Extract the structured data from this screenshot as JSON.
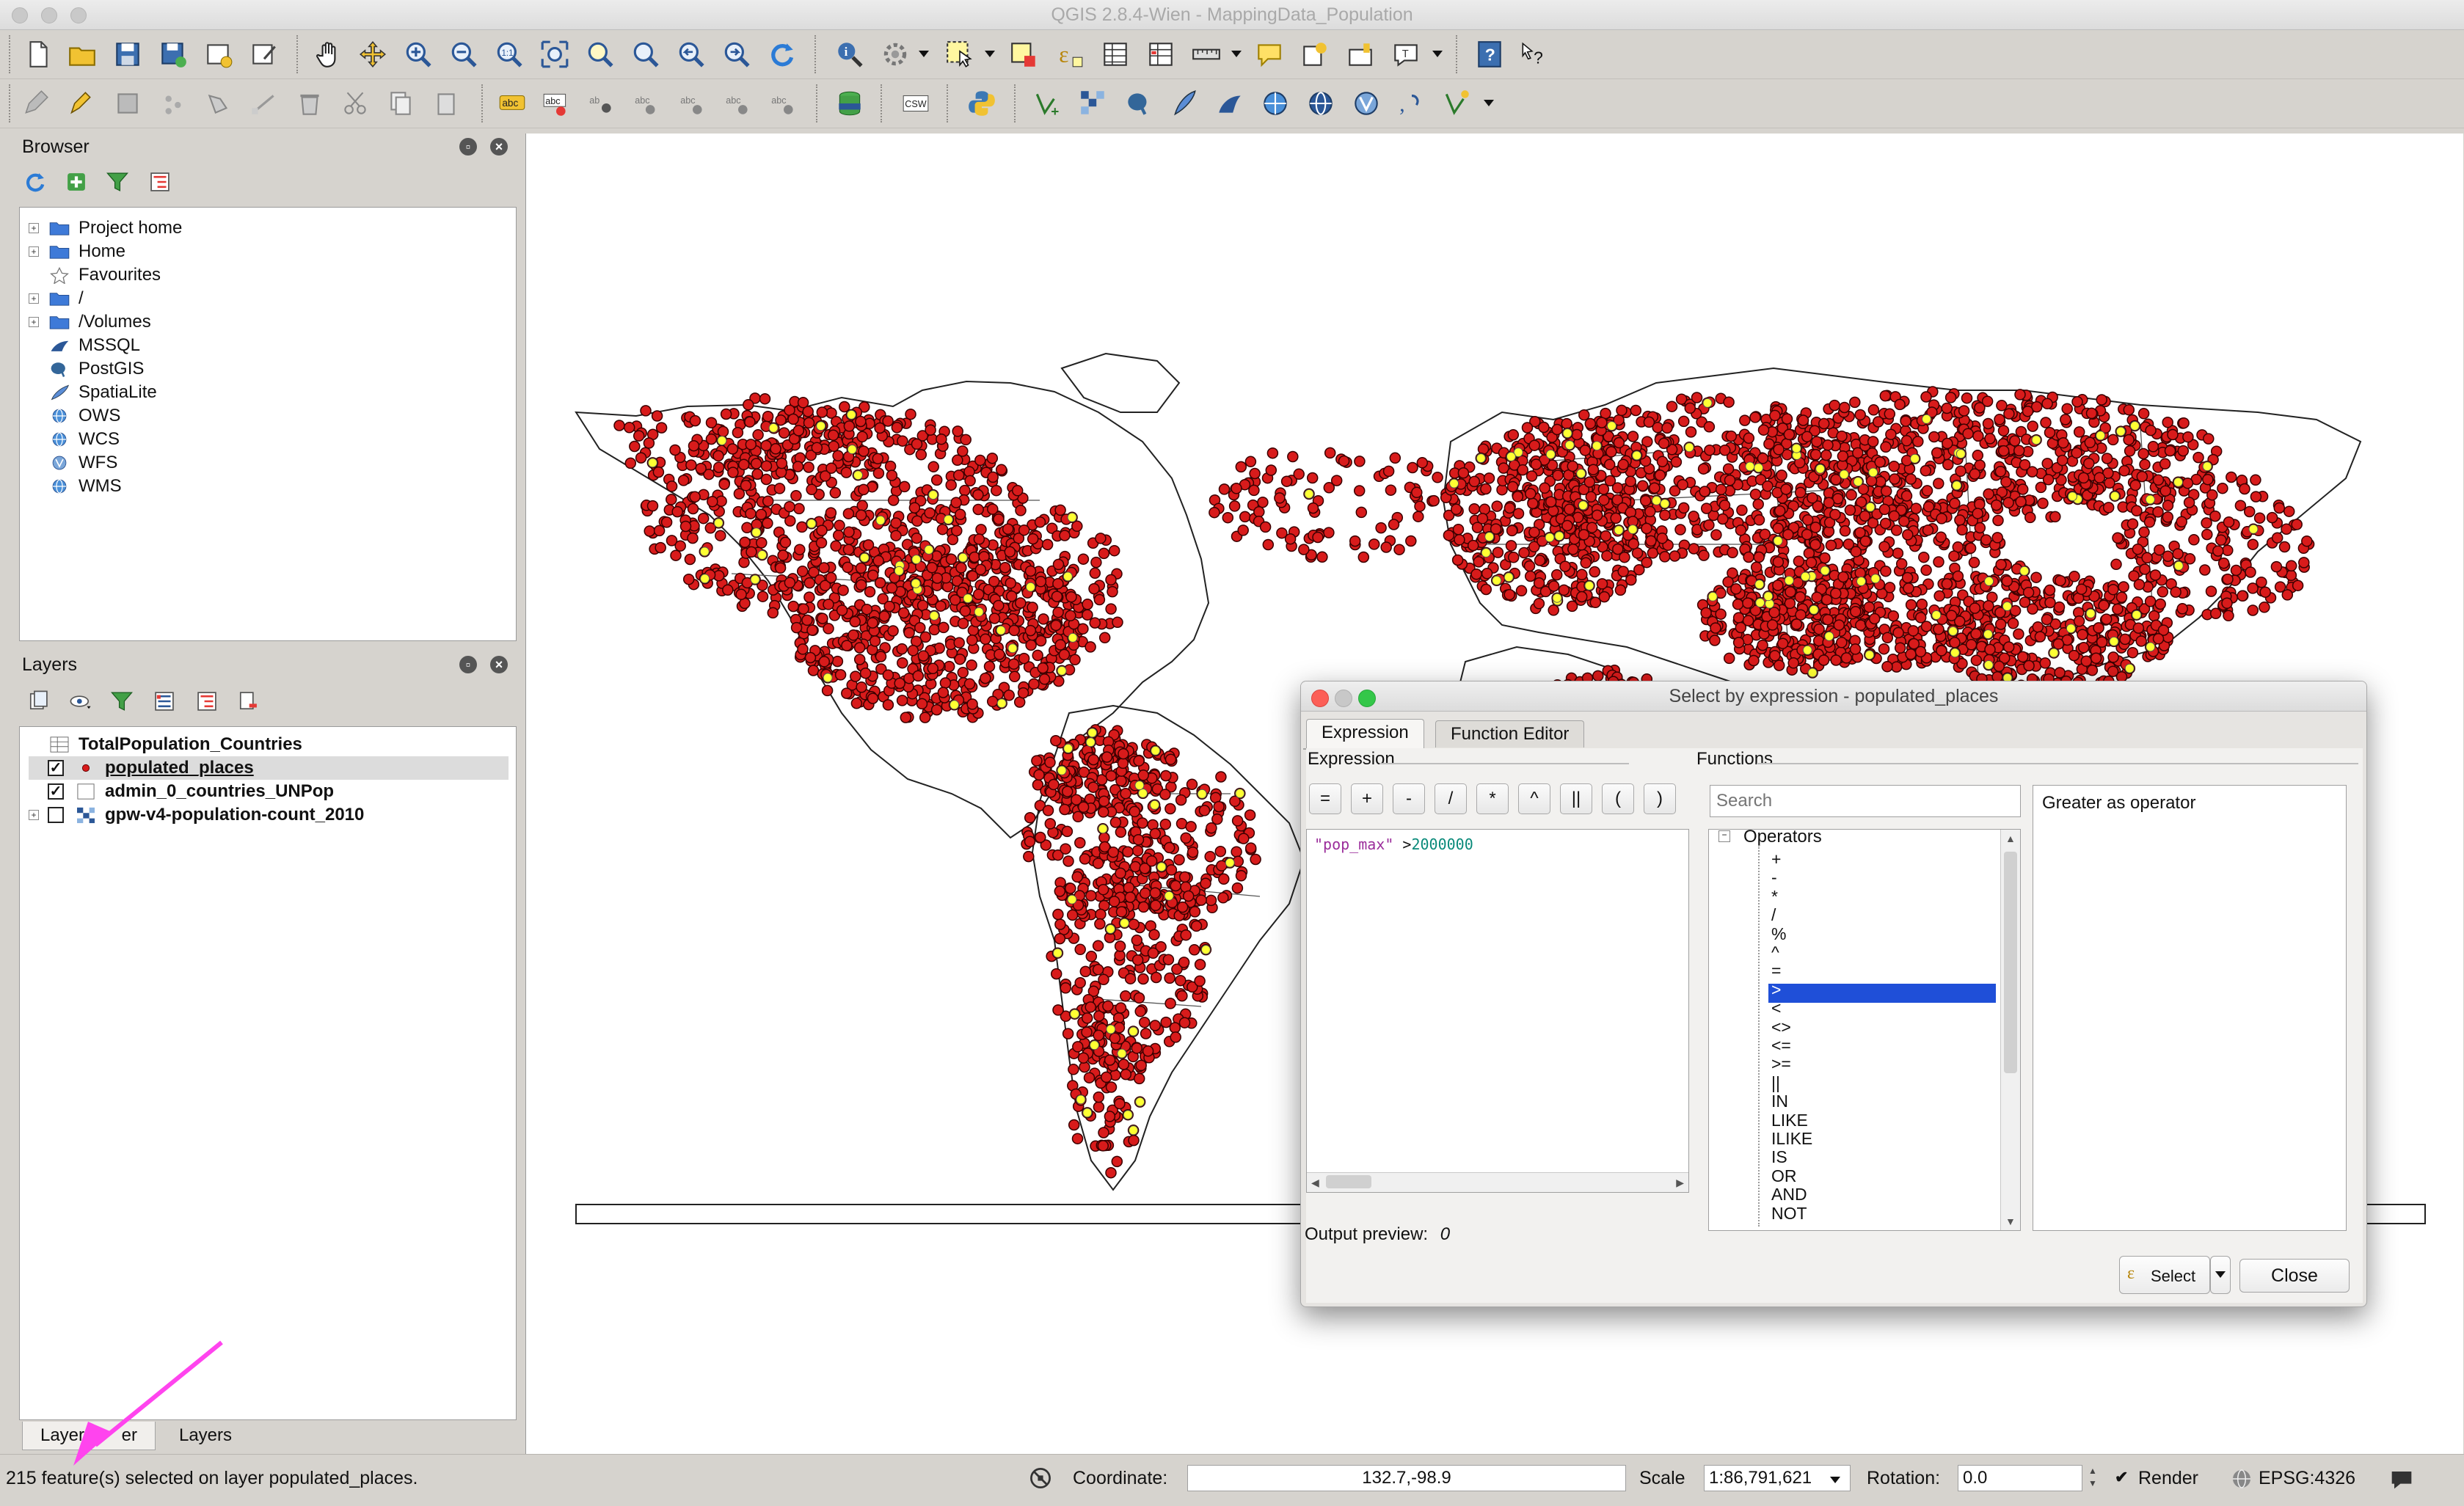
{
  "window": {
    "title": "QGIS 2.8.4-Wien - MappingData_Population"
  },
  "browser_panel": {
    "title": "Browser",
    "items": [
      {
        "label": "Project home",
        "icon": "folder-icon",
        "expandable": true
      },
      {
        "label": "Home",
        "icon": "folder-icon",
        "expandable": true
      },
      {
        "label": "Favourites",
        "icon": "star-icon",
        "expandable": false
      },
      {
        "label": "/",
        "icon": "folder-icon",
        "expandable": true
      },
      {
        "label": "/Volumes",
        "icon": "folder-icon",
        "expandable": true
      },
      {
        "label": "MSSQL",
        "icon": "mssql-icon",
        "expandable": false
      },
      {
        "label": "PostGIS",
        "icon": "postgis-elephant-icon",
        "expandable": false
      },
      {
        "label": "SpatiaLite",
        "icon": "spatialite-feather-icon",
        "expandable": false
      },
      {
        "label": "OWS",
        "icon": "globe-icon",
        "expandable": false
      },
      {
        "label": "WCS",
        "icon": "globe-icon",
        "expandable": false
      },
      {
        "label": "WFS",
        "icon": "wfs-icon",
        "expandable": false
      },
      {
        "label": "WMS",
        "icon": "globe-icon",
        "expandable": false
      }
    ]
  },
  "layers_panel": {
    "title": "Layers",
    "layers": [
      {
        "label": "TotalPopulation_Countries",
        "checked": null,
        "icon": "table-icon",
        "selected": false
      },
      {
        "label": "populated_places",
        "checked": true,
        "icon": "point-layer-icon",
        "selected": true
      },
      {
        "label": "admin_0_countries_UNPop",
        "checked": true,
        "icon": "polygon-layer-icon",
        "selected": false
      },
      {
        "label": "gpw-v4-population-count_2010",
        "checked": false,
        "icon": "raster-layer-icon",
        "selected": false
      }
    ],
    "bottom_tabs": [
      "Layer Order",
      "Layers"
    ],
    "bottom_tab_visible": [
      "Layer ",
      "er"
    ]
  },
  "dialog": {
    "title": "Select by expression - populated_places",
    "tabs": [
      "Expression",
      "Function Editor"
    ],
    "expression_label": "Expression",
    "functions_label": "Functions",
    "operator_buttons": [
      "=",
      "+",
      "-",
      "/",
      "*",
      "^",
      "||",
      "(",
      ")"
    ],
    "expression": {
      "field": "\"pop_max\"",
      "operator": ">",
      "value": "2000000"
    },
    "search_placeholder": "Search",
    "function_group": "Operators",
    "function_items": [
      "+",
      "-",
      "*",
      "/",
      "%",
      "^",
      "=",
      ">",
      "<",
      "<>",
      "<=",
      ">=",
      "||",
      "IN",
      "LIKE",
      "ILIKE",
      "IS",
      "OR",
      "AND",
      "NOT"
    ],
    "selected_function": ">",
    "help_text": "Greater as operator",
    "output_preview_label": "Output preview:",
    "output_preview_value": "0",
    "select_button": "Select",
    "close_button": "Close"
  },
  "statusbar": {
    "message": "215 feature(s) selected on layer populated_places.",
    "coordinate_label": "Coordinate:",
    "coordinate_value": "132.7,-98.9",
    "scale_label": "Scale",
    "scale_value": "1:86,791,621",
    "rotation_label": "Rotation:",
    "rotation_value": "0.0",
    "render_label": "Render",
    "render_checked": true,
    "crs": "EPSG:4326"
  },
  "colors": {
    "point_fill": "#d81b1b",
    "point_selected": "#ffff33",
    "annotation_arrow": "#ff44ee",
    "selection_blue": "#1f4fd8"
  }
}
